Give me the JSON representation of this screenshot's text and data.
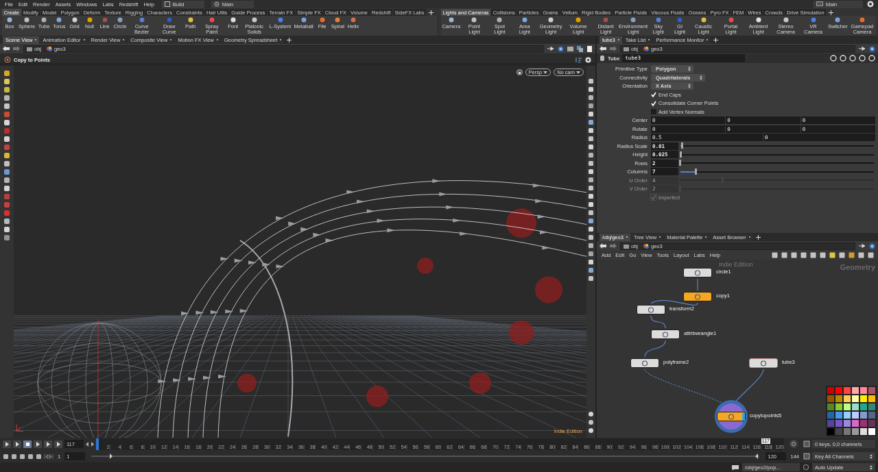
{
  "menu_bar": {
    "items": [
      "File",
      "Edit",
      "Render",
      "Assets",
      "Windows",
      "Labs",
      "Redshift",
      "Help"
    ],
    "desktop": "Build",
    "context": "Main",
    "right_context": "Main"
  },
  "shelf_left": {
    "tabs": [
      {
        "label": "Create",
        "selected": true
      },
      {
        "label": "Modify",
        "selected": false
      },
      {
        "label": "Model",
        "selected": false
      },
      {
        "label": "Polygon",
        "selected": false
      },
      {
        "label": "Deform",
        "selected": false
      },
      {
        "label": "Texture",
        "selected": false
      },
      {
        "label": "Rigging",
        "selected": false
      },
      {
        "label": "Characters",
        "selected": false
      },
      {
        "label": "Constraints",
        "selected": false
      },
      {
        "label": "Hair Utils",
        "selected": false
      },
      {
        "label": "Guide Process",
        "selected": false
      },
      {
        "label": "Terrain FX",
        "selected": false
      },
      {
        "label": "Simple FX",
        "selected": false
      },
      {
        "label": "Cloud FX",
        "selected": false
      },
      {
        "label": "Volume",
        "selected": false
      },
      {
        "label": "Redshift",
        "selected": false
      },
      {
        "label": "SideFX Labs",
        "selected": false
      }
    ],
    "tools": [
      "Box",
      "Sphere",
      "Tube",
      "Torus",
      "Grid",
      "Null",
      "Line",
      "Circle",
      "Curve Bezier",
      "Draw Curve",
      "Path",
      "Spray Paint",
      "Font",
      "Platonic Solids",
      "L-System",
      "Metaball",
      "File",
      "Spiral",
      "Helix"
    ]
  },
  "shelf_right": {
    "tabs": [
      {
        "label": "Lights and Cameras",
        "selected": true
      },
      {
        "label": "Collisions",
        "selected": false
      },
      {
        "label": "Particles",
        "selected": false
      },
      {
        "label": "Grains",
        "selected": false
      },
      {
        "label": "Vellum",
        "selected": false
      },
      {
        "label": "Rigid Bodies",
        "selected": false
      },
      {
        "label": "Particle Fluids",
        "selected": false
      },
      {
        "label": "Viscous Fluids",
        "selected": false
      },
      {
        "label": "Oceans",
        "selected": false
      },
      {
        "label": "Pyro FX",
        "selected": false
      },
      {
        "label": "FEM",
        "selected": false
      },
      {
        "label": "Wires",
        "selected": false
      },
      {
        "label": "Crowds",
        "selected": false
      },
      {
        "label": "Drive Simulation",
        "selected": false
      }
    ],
    "tools": [
      "Camera",
      "Point Light",
      "Spot Light",
      "Area Light",
      "Geometry Light",
      "Volume Light",
      "Distant Light",
      "Environment Light",
      "Sky Light",
      "GI Light",
      "Caustic Light",
      "Portal Light",
      "Ambient Light",
      "Stereo Camera",
      "VR Camera",
      "Switcher",
      "Gamepad Camera"
    ]
  },
  "viewer_pane": {
    "tabs": [
      {
        "label": "Scene View",
        "selected": true
      },
      {
        "label": "Animation Editor",
        "selected": false
      },
      {
        "label": "Render View",
        "selected": false
      },
      {
        "label": "Composite View",
        "selected": false
      },
      {
        "label": "Motion FX View",
        "selected": false
      },
      {
        "label": "Geometry Spreadsheet",
        "selected": false
      }
    ],
    "path": [
      "obj",
      "geo3"
    ],
    "title": "Copy to Points",
    "view_menu": "Persp",
    "camera_menu": "No cam",
    "edition": "Indie Edition"
  },
  "parameter_pane": {
    "tabs": [
      {
        "label": "tube3",
        "selected": true
      },
      {
        "label": "Take List",
        "selected": false
      },
      {
        "label": "Performance Monitor",
        "selected": false
      }
    ],
    "path": [
      "obj",
      "geo3"
    ],
    "node_type": "Tube",
    "node_name": "tube3",
    "parameters": [
      {
        "kind": "menu",
        "label": "Primitive Type",
        "value": "Polygon"
      },
      {
        "kind": "menu",
        "label": "Connectivity",
        "value": "Quadrilaterals"
      },
      {
        "kind": "menu",
        "label": "Orientation",
        "value": "X Axis"
      },
      {
        "kind": "toggle",
        "label": "End Caps",
        "checked": true,
        "disabled": false
      },
      {
        "kind": "toggle",
        "label": "Consolidate Corner Points",
        "checked": true,
        "disabled": false
      },
      {
        "kind": "toggle",
        "label": "Add Vertex Normals",
        "checked": false,
        "disabled": false
      },
      {
        "kind": "vector",
        "label": "Center",
        "values": [
          "0",
          "0",
          "0"
        ]
      },
      {
        "kind": "vector",
        "label": "Rotate",
        "values": [
          "0",
          "0",
          "0"
        ]
      },
      {
        "kind": "vector",
        "label": "Radius",
        "values": [
          "0.5",
          "0"
        ]
      },
      {
        "kind": "slider",
        "label": "Radius Scale",
        "value": "0.01",
        "level": 0.01,
        "disabled": false
      },
      {
        "kind": "slider",
        "label": "Height",
        "value": "0.025",
        "level": 0.003,
        "disabled": false
      },
      {
        "kind": "slider",
        "label": "Rows",
        "value": "2",
        "level": 0,
        "disabled": false
      },
      {
        "kind": "slider",
        "label": "Columns",
        "value": "7",
        "level": 0.08,
        "disabled": false
      },
      {
        "kind": "slider",
        "label": "U Order",
        "value": "4",
        "level": 0.22,
        "disabled": true
      },
      {
        "kind": "slider",
        "label": "V Order",
        "value": "2",
        "level": 0,
        "disabled": true
      },
      {
        "kind": "toggle",
        "label": "Imperfect",
        "checked": true,
        "disabled": true
      }
    ]
  },
  "network_pane": {
    "tabs": [
      {
        "label": "/obj/geo3",
        "selected": true
      },
      {
        "label": "Tree View",
        "selected": false
      },
      {
        "label": "Material Palette",
        "selected": false
      },
      {
        "label": "Asset Browser",
        "selected": false
      }
    ],
    "path": [
      "obj",
      "geo3"
    ],
    "menu": [
      "Add",
      "Edit",
      "Go",
      "View",
      "Tools",
      "Layout",
      "Labs",
      "Help"
    ],
    "edition": "Indie Edition",
    "context": "Geometry",
    "nodes": [
      {
        "label": "circle1",
        "color": "#dcdcdc",
        "display": false,
        "current": false
      },
      {
        "label": "copy1",
        "color": "#f5a623",
        "display": false,
        "current": false
      },
      {
        "label": "transform2",
        "color": "#dcdcdc",
        "display": false,
        "current": false
      },
      {
        "label": "attribwrangle1",
        "color": "#dcdcdc",
        "display": false,
        "current": false
      },
      {
        "label": "polyframe2",
        "color": "#dcdcdc",
        "display": false,
        "current": false
      },
      {
        "label": "tube3",
        "color": "#dcdcdc",
        "display": false,
        "current": true
      },
      {
        "label": "copytopoints5",
        "color": "#f5a623",
        "display": true,
        "current": false
      }
    ],
    "palette": [
      {
        "color": "#cc0000"
      },
      {
        "color": "#ff0000"
      },
      {
        "color": "#ff4444"
      },
      {
        "color": "#ffaaaa"
      },
      {
        "color": "#ff8899"
      },
      {
        "color": "#aa5566"
      },
      {
        "color": "#995500"
      },
      {
        "color": "#bb8800"
      },
      {
        "color": "#ffcc55"
      },
      {
        "color": "#ffffaa"
      },
      {
        "color": "#ffee00"
      },
      {
        "color": "#ffbb00"
      },
      {
        "color": "#558822"
      },
      {
        "color": "#88cc33"
      },
      {
        "color": "#bbff88"
      },
      {
        "color": "#99ddcc"
      },
      {
        "color": "#22aa88"
      },
      {
        "color": "#338877"
      },
      {
        "color": "#2266aa"
      },
      {
        "color": "#4499ee"
      },
      {
        "color": "#99ccff"
      },
      {
        "color": "#bbccff"
      },
      {
        "color": "#8899cc"
      },
      {
        "color": "#556688"
      },
      {
        "color": "#554499"
      },
      {
        "color": "#7755cc"
      },
      {
        "color": "#9988dd"
      },
      {
        "color": "#dd66cc"
      },
      {
        "color": "#993377"
      },
      {
        "color": "#663355"
      },
      {
        "color": "#000000"
      },
      {
        "color": "#444444"
      },
      {
        "color": "#777777"
      },
      {
        "color": "#999999"
      },
      {
        "color": "#dddddd"
      },
      {
        "color": "#ffffff"
      }
    ]
  },
  "timeline": {
    "frame": "117",
    "ruler": [
      "2",
      "4",
      "6",
      "8",
      "10",
      "12",
      "14",
      "16",
      "18",
      "20",
      "22",
      "24",
      "26",
      "28",
      "30",
      "32",
      "34",
      "36",
      "38",
      "40",
      "42",
      "44",
      "46",
      "48",
      "50",
      "52",
      "54",
      "56",
      "58",
      "60",
      "62",
      "64",
      "66",
      "68",
      "70",
      "72",
      "74",
      "76",
      "78",
      "80",
      "82",
      "84",
      "86",
      "88",
      "90",
      "92",
      "94",
      "96",
      "98",
      "100",
      "102",
      "104",
      "106",
      "108",
      "110",
      "112",
      "114",
      "116",
      "118",
      "120"
    ],
    "marker": "117",
    "range_handles": [
      {
        "level": 0.03
      },
      {
        "level": 0.995
      }
    ],
    "range_start": "1",
    "range_start_2": "1",
    "range_end": "120",
    "range_end_2": "144",
    "keys": "0 keys, 0,0 channels",
    "key_button": "Key All Channels"
  },
  "status_bar": {
    "path": "/obj/geo2/pop...",
    "update": "Auto Update"
  }
}
